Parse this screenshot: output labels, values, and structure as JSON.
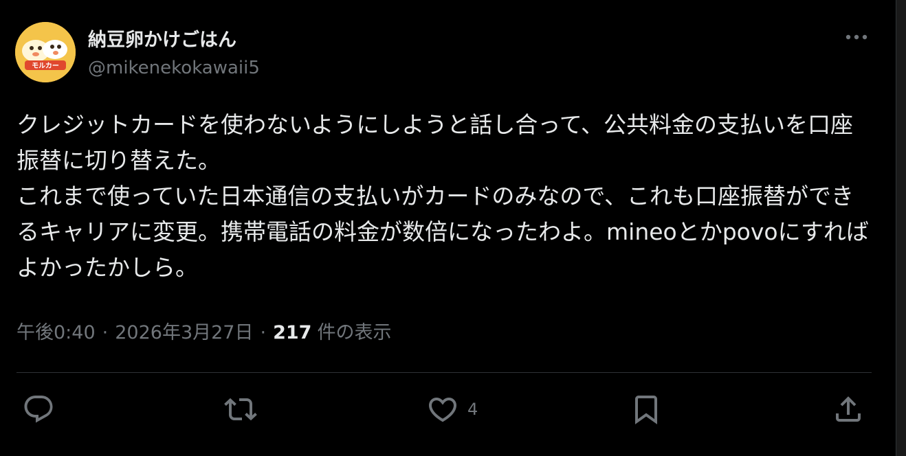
{
  "author": {
    "display_name": "納豆卵かけごはん",
    "handle": "@mikenekokawaii5",
    "avatar_text": "モルカー"
  },
  "tweet": {
    "text": "クレジットカードを使わないようにしようと話し合って、公共料金の支払いを口座振替に切り替えた。\nこれまで使っていた日本通信の支払いがカードのみなので、これも口座振替ができるキャリアに変更。携帯電話の料金が数倍になったわよ。mineoとかpovoにすればよかったかしら。"
  },
  "meta": {
    "time": "午後0:40",
    "separator": "·",
    "date": "2026年3月27日",
    "views_count": "217",
    "views_label": "件の表示"
  },
  "actions": {
    "reply_icon": "reply-icon",
    "retweet_icon": "retweet-icon",
    "like_icon": "heart-icon",
    "like_count": "4",
    "bookmark_icon": "bookmark-icon",
    "share_icon": "share-icon",
    "more_icon": "more-icon"
  },
  "colors": {
    "background": "#000000",
    "primary_text": "#e7e9ea",
    "secondary_text": "#71767b",
    "divider": "#2f3336",
    "avatar_bg": "#f4c44a"
  }
}
